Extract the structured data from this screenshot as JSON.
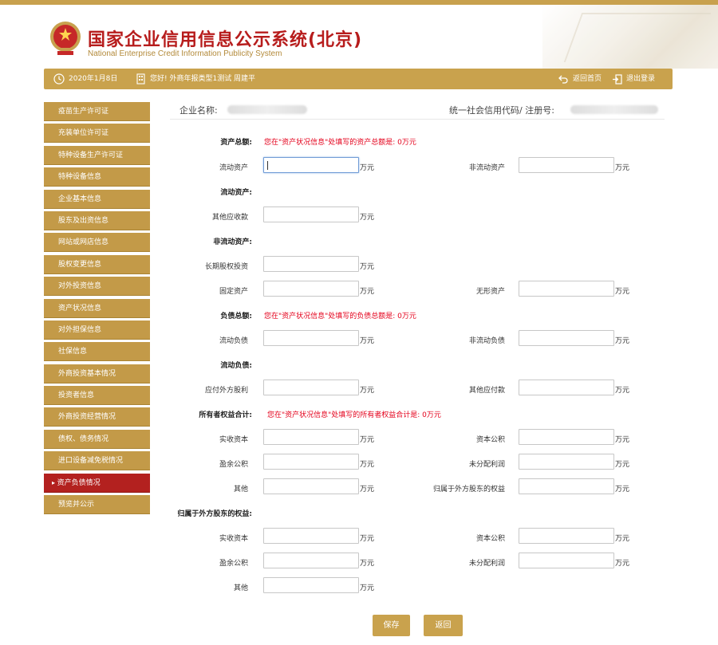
{
  "header": {
    "title": "国家企业信用信息公示系统(北京)",
    "subtitle": "National Enterprise Credit Information Publicity System"
  },
  "navbar": {
    "date": "2020年1月8日",
    "greeting": "您好! 外商年报类型1测试  周建平",
    "home": "返回首页",
    "logout": "退出登录"
  },
  "sidebar": {
    "items": [
      {
        "label": "疫苗生产许可证"
      },
      {
        "label": "充装单位许可证"
      },
      {
        "label": "特种设备生产许可证"
      },
      {
        "label": "特种设备信息"
      },
      {
        "label": "企业基本信息"
      },
      {
        "label": "股东及出资信息"
      },
      {
        "label": "网站或网店信息"
      },
      {
        "label": "股权变更信息"
      },
      {
        "label": "对外投资信息"
      },
      {
        "label": "资产状况信息"
      },
      {
        "label": "对外担保信息"
      },
      {
        "label": "社保信息"
      },
      {
        "label": "外商投资基本情况"
      },
      {
        "label": "投资者信息"
      },
      {
        "label": "外商投资经营情况"
      },
      {
        "label": "债权、债务情况"
      },
      {
        "label": "进口设备减免税情况"
      },
      {
        "label": "资产负债情况",
        "active": true
      },
      {
        "label": "预览并公示"
      }
    ]
  },
  "info": {
    "company_label": "企业名称:",
    "code_label": "统一社会信用代码/ 注册号:"
  },
  "form": {
    "unit": "万元",
    "sections": {
      "total_assets": "资产总额:",
      "current_assets": "流动资产:",
      "noncurrent_assets": "非流动资产:",
      "total_liabilities": "负债总额:",
      "current_liabilities": "流动负债:",
      "equity_total": "所有者权益合计:",
      "foreign_equity": "归属于外方股东的权益:"
    },
    "notices": {
      "assets": "您在\"资产状况信息\"处填写的资产总额是: 0万元",
      "liabilities": "您在\"资产状况信息\"处填写的负债总额是: 0万元",
      "equity": "您在\"资产状况信息\"处填写的所有者权益合计是: 0万元"
    },
    "labels": {
      "current_assets": "流动资产",
      "noncurrent_assets": "非流动资产",
      "other_receivables": "其他应收款",
      "lt_equity_invest": "长期股权投资",
      "fixed_assets": "固定资产",
      "intangible_assets": "无形资产",
      "current_liab": "流动负债",
      "noncurrent_liab": "非流动负债",
      "dividends_payable": "应付外方股利",
      "other_payables": "其他应付款",
      "paid_in_capital": "实收资本",
      "capital_reserve": "资本公积",
      "surplus_reserve": "盈余公积",
      "undistributed_profit": "未分配利润",
      "other": "其他",
      "foreign_equity_label": "归属于外方股东的权益",
      "f_paid_in_capital": "实收资本",
      "f_capital_reserve": "资本公积",
      "f_surplus_reserve": "盈余公积",
      "f_undistributed_profit": "未分配利润",
      "f_other": "其他"
    }
  },
  "buttons": {
    "save": "保存",
    "back": "返回"
  },
  "colors": {
    "gold": "#c9a24d",
    "active_red": "#b3211f",
    "notice_red": "#e4001b",
    "title_red": "#b71c1c"
  }
}
